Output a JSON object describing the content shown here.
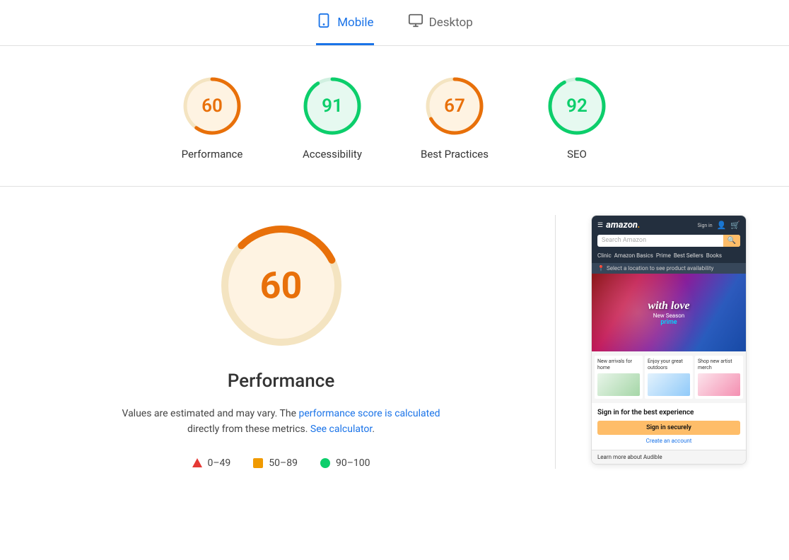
{
  "tabs": [
    {
      "id": "mobile",
      "label": "Mobile",
      "active": true,
      "icon": "📱"
    },
    {
      "id": "desktop",
      "label": "Desktop",
      "active": false,
      "icon": "🖥"
    }
  ],
  "scores": [
    {
      "id": "performance",
      "value": 60,
      "label": "Performance",
      "color": "#e8700a",
      "bg": "#fef3e2",
      "trackColor": "#f4e4c1",
      "percentage": 60
    },
    {
      "id": "accessibility",
      "value": 91,
      "label": "Accessibility",
      "color": "#0cce6b",
      "bg": "#e6f9f0",
      "trackColor": "#d0f0e0",
      "percentage": 91
    },
    {
      "id": "best-practices",
      "value": 67,
      "label": "Best Practices",
      "color": "#e8700a",
      "bg": "#fef3e2",
      "trackColor": "#f4e4c1",
      "percentage": 67
    },
    {
      "id": "seo",
      "value": 92,
      "label": "SEO",
      "color": "#0cce6b",
      "bg": "#e6f9f0",
      "trackColor": "#d0f0e0",
      "percentage": 92
    }
  ],
  "main": {
    "big_score": 60,
    "big_score_label": "Performance",
    "description_text": "Values are estimated and may vary. The ",
    "link1_text": "performance score is calculated",
    "link1_url": "#",
    "description_middle": " directly from these metrics. ",
    "link2_text": "See calculator",
    "link2_url": "#",
    "description_end": "."
  },
  "legend": [
    {
      "id": "fail",
      "range": "0–49",
      "type": "triangle"
    },
    {
      "id": "average",
      "range": "50–89",
      "type": "square"
    },
    {
      "id": "pass",
      "range": "90–100",
      "type": "circle"
    }
  ],
  "phone": {
    "nav_links": [
      "Clinic",
      "Amazon Basics",
      "Prime",
      "Best Sellers",
      "Books"
    ],
    "search_placeholder": "Search Amazon",
    "location_text": "Select a location to see product availability",
    "hero_text": "with love",
    "hero_sub": "New Season\nprime",
    "cards": [
      {
        "title": "New arrivals for home"
      },
      {
        "title": "Enjoy your great outdoors"
      },
      {
        "title": "Shop new artist merch"
      }
    ],
    "signin_title": "Sign in for the best experience",
    "signin_btn": "Sign in securely",
    "create_account": "Create an account",
    "audible_text": "Learn more about Audible"
  }
}
